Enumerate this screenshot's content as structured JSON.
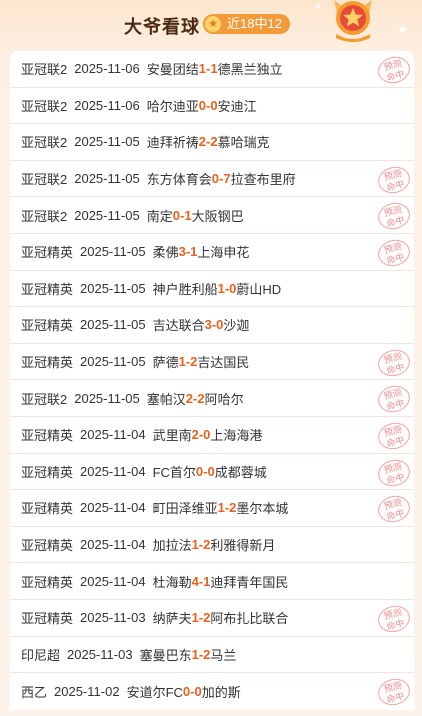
{
  "header": {
    "title": "大爷看球",
    "record": "近18中12"
  },
  "stamp_text": [
    "预测",
    "命中"
  ],
  "rows": [
    {
      "league": "亚冠联2",
      "date": "2025-11-06",
      "home": "安曼团结",
      "hs": "1",
      "sep": " - ",
      "as": "1",
      "away": "德黑兰独立",
      "hit": true
    },
    {
      "league": "亚冠联2",
      "date": "2025-11-06",
      "home": "哈尔迪亚",
      "hs": "0",
      "sep": " - ",
      "as": "0",
      "away": "安迪江",
      "hit": false
    },
    {
      "league": "亚冠联2",
      "date": "2025-11-05",
      "home": "迪拜祈祷",
      "hs": "2",
      "sep": " - ",
      "as": "2",
      "away": "慕哈瑞克",
      "hit": false
    },
    {
      "league": "亚冠联2",
      "date": "2025-11-05",
      "home": "东方体育会",
      "hs": "0",
      "sep": " - ",
      "as": "7",
      "away": "拉查布里府",
      "hit": true
    },
    {
      "league": "亚冠联2",
      "date": "2025-11-05",
      "home": "南定",
      "hs": "0",
      "sep": " - ",
      "as": "1",
      "away": "大阪钢巴",
      "hit": true
    },
    {
      "league": "亚冠精英",
      "date": "2025-11-05",
      "home": "柔佛",
      "hs": "3",
      "sep": " - ",
      "as": "1",
      "away": "上海申花",
      "hit": true
    },
    {
      "league": "亚冠精英",
      "date": "2025-11-05",
      "home": "神户胜利船",
      "hs": "1",
      "sep": " - ",
      "as": "0",
      "away": "蔚山HD",
      "hit": false
    },
    {
      "league": "亚冠精英",
      "date": "2025-11-05",
      "home": "吉达联合",
      "hs": "3",
      "sep": " - ",
      "as": "0",
      "away": "沙迦",
      "hit": false
    },
    {
      "league": "亚冠精英",
      "date": "2025-11-05",
      "home": "萨德",
      "hs": "1",
      "sep": " - ",
      "as": "2",
      "away": "吉达国民",
      "hit": true
    },
    {
      "league": "亚冠联2",
      "date": "2025-11-05",
      "home": "塞帕汉",
      "hs": "2",
      "sep": " - ",
      "as": "2",
      "away": "阿哈尔",
      "hit": true
    },
    {
      "league": "亚冠精英",
      "date": "2025-11-04",
      "home": "武里南",
      "hs": "2",
      "sep": " - ",
      "as": "0",
      "away": "上海海港",
      "hit": true
    },
    {
      "league": "亚冠精英",
      "date": "2025-11-04",
      "home": "FC首尔",
      "hs": "0",
      "sep": " - ",
      "as": "0",
      "away": "成都蓉城",
      "hit": true
    },
    {
      "league": "亚冠精英",
      "date": "2025-11-04",
      "home": "町田泽维亚",
      "hs": "1",
      "sep": " - ",
      "as": "2",
      "away": "墨尔本城",
      "hit": true
    },
    {
      "league": "亚冠精英",
      "date": "2025-11-04",
      "home": "加拉法",
      "hs": "1",
      "sep": " - ",
      "as": "2",
      "away": "利雅得新月",
      "hit": false
    },
    {
      "league": "亚冠精英",
      "date": "2025-11-04",
      "home": "杜海勒",
      "hs": "4",
      "sep": " - ",
      "as": "1",
      "away": "迪拜青年国民",
      "hit": false
    },
    {
      "league": "亚冠精英",
      "date": "2025-11-03",
      "home": "纳萨夫",
      "hs": "1",
      "sep": " - ",
      "as": "2",
      "away": "阿布扎比联合",
      "hit": true
    },
    {
      "league": "印尼超",
      "date": "2025-11-03",
      "home": "塞曼巴东",
      "hs": "1",
      "sep": " - ",
      "as": "2",
      "away": "马兰",
      "hit": false
    },
    {
      "league": "西乙",
      "date": "2025-11-02",
      "home": "安道尔FC",
      "hs": "0",
      "sep": " - ",
      "as": "0",
      "away": "加的斯",
      "hit": true
    }
  ]
}
